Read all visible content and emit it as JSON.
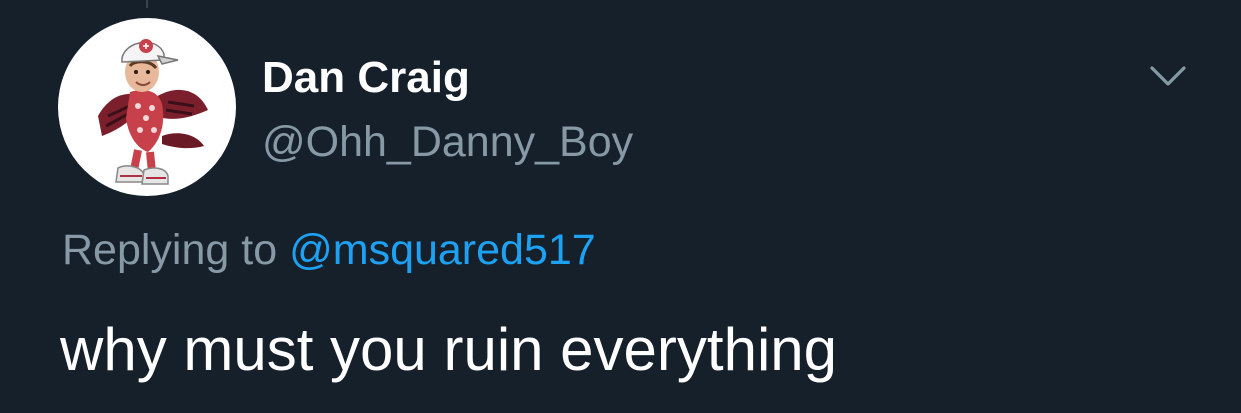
{
  "tweet": {
    "author": {
      "display_name": "Dan Craig",
      "handle": "@Ohh_Danny_Boy",
      "avatar_icon": "gamecock-mascot-avatar"
    },
    "reply_context": {
      "label": "Replying to",
      "mention": "@msquared517"
    },
    "text": "why must you ruin everything",
    "menu_icon": "chevron-down-icon"
  },
  "colors": {
    "background": "#15202b",
    "primary_text": "#ffffff",
    "secondary_text": "#8899a6",
    "link": "#1da1f2"
  }
}
